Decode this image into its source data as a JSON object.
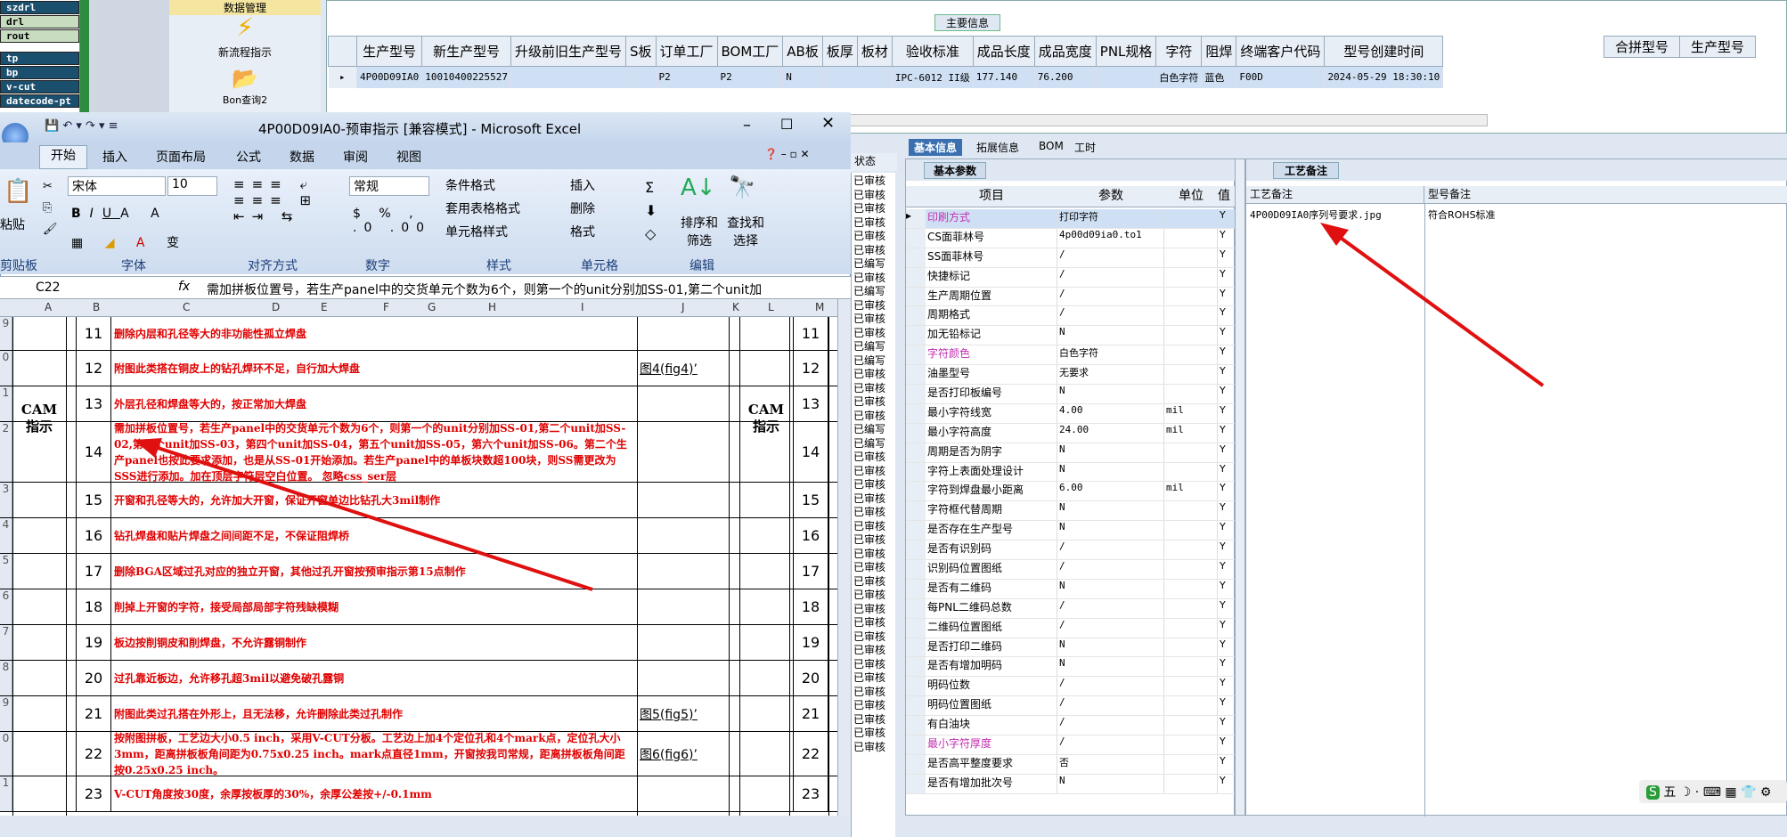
{
  "left_list": [
    "szdrl",
    "drl",
    "rout",
    "tp",
    "bp",
    "v-cut",
    "datecode-pt"
  ],
  "toolbar": {
    "item1": "数据管理",
    "item2": "新流程指示",
    "item3": "Bon查询2"
  },
  "main_info": {
    "title": "主要信息",
    "headers": [
      "生产型号",
      "新生产型号",
      "升级前旧生产型号",
      "S板",
      "订单工厂",
      "BOM工厂",
      "AB板",
      "板厚",
      "板材",
      "验收标准",
      "成品长度",
      "成品宽度",
      "PNL规格",
      "字符",
      "阻焊",
      "终端客户代码",
      "型号创建时间"
    ],
    "row": [
      "4P00D09IA0",
      "10010400225527",
      "",
      "",
      "P2",
      "P2",
      "N",
      "",
      "",
      "IPC-6012 II级",
      "177.140",
      "76.200",
      "",
      "白色字符",
      "蓝色",
      "F00D",
      "2024-05-29 18:30:10"
    ],
    "merge_headers": [
      "合拼型号",
      "生产型号"
    ]
  },
  "excel": {
    "title": "4P00D09IA0-预审指示  [兼容模式] - Microsoft Excel",
    "tabs": [
      "开始",
      "插入",
      "页面布局",
      "公式",
      "数据",
      "审阅",
      "视图"
    ],
    "font_name": "宋体",
    "font_size": "10",
    "number_format": "常规",
    "ribbon": {
      "paste": "粘贴",
      "clipboard": "剪贴板",
      "font": "字体",
      "align": "对齐方式",
      "number": "数字",
      "styles": "样式",
      "cells": "单元格",
      "edit": "编辑",
      "cond": "条件格式",
      "table": "套用表格格式",
      "cellstyle": "单元格样式",
      "insert": "插入",
      "delete": "删除",
      "format": "格式",
      "sort": "排序和筛选",
      "find": "查找和选择"
    },
    "cell_ref": "C22",
    "formula": "需加拼板位置号，若生产panel中的交货单元个数为6个，则第一个的unit分别加SS-01,第二个unit加",
    "columns": [
      "A",
      "B",
      "C",
      "D",
      "E",
      "F",
      "G",
      "H",
      "I",
      "J",
      "K",
      "L",
      "M"
    ],
    "cam_label": "CAM\n指示",
    "rows": [
      {
        "rn": "9",
        "no": "11",
        "text": "删除内层和孔径等大的非功能性孤立焊盘",
        "ref": ""
      },
      {
        "rn": "0",
        "no": "12",
        "text": "附图此类搭在铜皮上的钻孔焊环不足，自行加大焊盘",
        "ref": "图4(fig4)’"
      },
      {
        "rn": "1",
        "no": "13",
        "text": "外层孔径和焊盘等大的，按正常加大焊盘",
        "ref": ""
      },
      {
        "rn": "2",
        "no": "14",
        "text": "需加拼板位置号，若生产panel中的交货单元个数为6个，则第一个的unit分别加SS-01,第二个unit加SS-02,第三个unit加SS-03，第四个unit加SS-04，第五个unit加SS-05，第六个unit加SS-06。第二个生产panel也按此要求添加，也是从SS-01开始添加。若生产panel中的单板块数超100块，则SS需更改为SSS进行添加。加在顶层字符层空白位置。 忽略css_ser层",
        "ref": ""
      },
      {
        "rn": "3",
        "no": "15",
        "text": "开窗和孔径等大的，允许加大开窗，保证开窗单边比钻孔大3mil制作",
        "ref": ""
      },
      {
        "rn": "4",
        "no": "16",
        "text": "钻孔焊盘和贴片焊盘之间间距不足，不保证阻焊桥",
        "ref": ""
      },
      {
        "rn": "5",
        "no": "17",
        "text": "删除BGA区域过孔对应的独立开窗，其他过孔开窗按预审指示第15点制作",
        "ref": ""
      },
      {
        "rn": "6",
        "no": "18",
        "text": "削掉上开窗的字符，接受局部局部字符残缺模糊",
        "ref": ""
      },
      {
        "rn": "7",
        "no": "19",
        "text": "板边按削铜皮和削焊盘，不允许露铜制作",
        "ref": ""
      },
      {
        "rn": "8",
        "no": "20",
        "text": "过孔靠近板边，允许移孔超3mil以避免破孔露铜",
        "ref": ""
      },
      {
        "rn": "9",
        "no": "21",
        "text": "附图此类过孔搭在外形上，且无法移，允许删除此类过孔制作",
        "ref": "图5(fig5)’"
      },
      {
        "rn": "0",
        "no": "22",
        "text": "按附图拼板，工艺边大小0.5 inch，采用V-CUT分板。工艺边上加4个定位孔和4个mark点，定位孔大小3mm，距离拼板板角间距为0.75x0.25 inch。mark点直径1mm，开窗按我司常规，距离拼板板角间距按0.25x0.25 inch。",
        "ref": "图6(fig6)’"
      },
      {
        "rn": "1",
        "no": "23",
        "text": "V-CUT角度按30度，余厚按板厚的30%，余厚公差按+/-0.1mm",
        "ref": ""
      }
    ]
  },
  "status_col": {
    "header": "状态",
    "items": [
      "已审核",
      "已审核",
      "已审核",
      "已审核",
      "已审核",
      "已审核",
      "已编写",
      "已审核",
      "已编写",
      "已审核",
      "已审核",
      "已审核",
      "已编写",
      "已编写",
      "已审核",
      "已审核",
      "已审核",
      "已审核",
      "已编写",
      "已编写",
      "已审核",
      "已审核",
      "已审核",
      "已审核",
      "已审核",
      "已审核",
      "已审核",
      "已审核",
      "已审核",
      "已审核",
      "已审核",
      "已审核",
      "已审核",
      "已审核",
      "已审核",
      "已审核",
      "已审核",
      "已审核",
      "已审核",
      "已审核",
      "已审核",
      "已审核"
    ]
  },
  "right_tabs": [
    "基本信息",
    "拓展信息",
    "BOM",
    "工时"
  ],
  "basic_params": {
    "title": "基本参数",
    "headers": [
      "项目",
      "参数",
      "单位",
      "值"
    ],
    "rows": [
      {
        "item": "印刷方式",
        "val": "打印字符",
        "unit": "",
        "y": "Y",
        "pink": true
      },
      {
        "item": "CS面菲林号",
        "val": "4p00d09ia0.to1",
        "unit": "",
        "y": "Y"
      },
      {
        "item": "SS面菲林号",
        "val": "/",
        "unit": "",
        "y": "Y"
      },
      {
        "item": "快捷标记",
        "val": "/",
        "unit": "",
        "y": "Y"
      },
      {
        "item": "生产周期位置",
        "val": "/",
        "unit": "",
        "y": "Y"
      },
      {
        "item": "周期格式",
        "val": "/",
        "unit": "",
        "y": "Y"
      },
      {
        "item": "加无铅标记",
        "val": "N",
        "unit": "",
        "y": "Y"
      },
      {
        "item": "字符颜色",
        "val": "白色字符",
        "unit": "",
        "y": "Y",
        "pink": true
      },
      {
        "item": "油墨型号",
        "val": "无要求",
        "unit": "",
        "y": "Y"
      },
      {
        "item": "是否打印板编号",
        "val": "N",
        "unit": "",
        "y": "Y"
      },
      {
        "item": "最小字符线宽",
        "val": "4.00",
        "unit": "mil",
        "y": "Y"
      },
      {
        "item": "最小字符高度",
        "val": "24.00",
        "unit": "mil",
        "y": "Y"
      },
      {
        "item": "周期是否为阴字",
        "val": "N",
        "unit": "",
        "y": "Y"
      },
      {
        "item": "字符上表面处理设计",
        "val": "N",
        "unit": "",
        "y": "Y"
      },
      {
        "item": "字符到焊盘最小距离",
        "val": "6.00",
        "unit": "mil",
        "y": "Y"
      },
      {
        "item": "字符框代替周期",
        "val": "N",
        "unit": "",
        "y": "Y"
      },
      {
        "item": "是否存在生产型号",
        "val": "N",
        "unit": "",
        "y": "Y"
      },
      {
        "item": "是否有识别码",
        "val": "/",
        "unit": "",
        "y": "Y"
      },
      {
        "item": "识别码位置图纸",
        "val": "/",
        "unit": "",
        "y": "Y"
      },
      {
        "item": "是否有二维码",
        "val": "N",
        "unit": "",
        "y": "Y"
      },
      {
        "item": "每PNL二维码总数",
        "val": "/",
        "unit": "",
        "y": "Y"
      },
      {
        "item": "二维码位置图纸",
        "val": "/",
        "unit": "",
        "y": "Y"
      },
      {
        "item": "是否打印二维码",
        "val": "N",
        "unit": "",
        "y": "Y"
      },
      {
        "item": "是否有增加明码",
        "val": "N",
        "unit": "",
        "y": "Y"
      },
      {
        "item": "明码位数",
        "val": "/",
        "unit": "",
        "y": "Y"
      },
      {
        "item": "明码位置图纸",
        "val": "/",
        "unit": "",
        "y": "Y"
      },
      {
        "item": "有白油块",
        "val": "/",
        "unit": "",
        "y": "Y"
      },
      {
        "item": "最小字符厚度",
        "val": "/",
        "unit": "",
        "y": "Y",
        "pink": true
      },
      {
        "item": "是否高平整度要求",
        "val": "否",
        "unit": "",
        "y": "Y"
      },
      {
        "item": "是否有增加批次号",
        "val": "N",
        "unit": "",
        "y": "Y"
      }
    ]
  },
  "craft_remark": {
    "title": "工艺备注",
    "headers": [
      "工艺备注",
      "型号备注"
    ],
    "remark": "4P00D09IA0序列号要求.jpg",
    "model_remark": "符合ROHS标准"
  },
  "tray": "五"
}
